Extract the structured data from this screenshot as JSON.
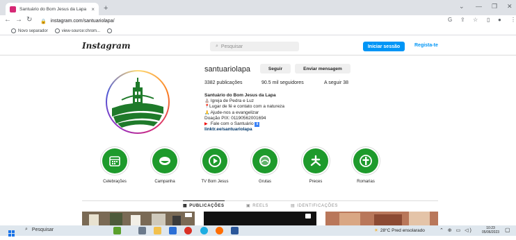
{
  "browser": {
    "tab_title": "Santuário do Bom Jesus da Lapa",
    "tab_close": "×",
    "new_tab": "+",
    "url": "instagram.com/santuariolapa/",
    "bookmarks": [
      {
        "label": "Novo separador"
      },
      {
        "label": "view-source:chrom..."
      }
    ]
  },
  "header": {
    "logo": "Instagram",
    "search_placeholder": "Pesquisar",
    "login_label": "Iniciar sessão",
    "register_label": "Regista-te"
  },
  "profile": {
    "username": "santuariolapa",
    "follow_label": "Seguir",
    "message_label": "Enviar mensagem",
    "posts": "3382 publicações",
    "followers": "90.5 mil seguidores",
    "following": "A seguir 38",
    "bio_name": "Santuário do Bom Jesus da Lapa",
    "bio_lines": [
      "Igreja de Pedra e Luz",
      "Lugar de fé e contato com a natureza",
      "Ajude-nos a evangelizar",
      "Doação PIX: 01190562001694",
      "Fale com o Santuário"
    ],
    "link": "linktr.ee/santuariolapa"
  },
  "highlights": [
    {
      "label": "Celebrações",
      "icon": "calendar-icon"
    },
    {
      "label": "Campanha",
      "icon": "bowl-icon"
    },
    {
      "label": "TV Bom Jesus",
      "icon": "play-icon"
    },
    {
      "label": "Grutas",
      "icon": "grotto-icon"
    },
    {
      "label": "Preces",
      "icon": "dove-icon"
    },
    {
      "label": "Romarias",
      "icon": "cross-icon"
    }
  ],
  "post_tabs": [
    "PUBLICAÇÕES",
    "REELS",
    "IDENTIFICAÇÕES"
  ],
  "taskbar": {
    "search_label": "Pesquisar",
    "weather": "28°C Pred ensolarado",
    "time": "10:23",
    "date": "05/06/2023"
  },
  "colors": {
    "brand_green": "#1e9a2c",
    "accent_blue": "#0095f6"
  }
}
